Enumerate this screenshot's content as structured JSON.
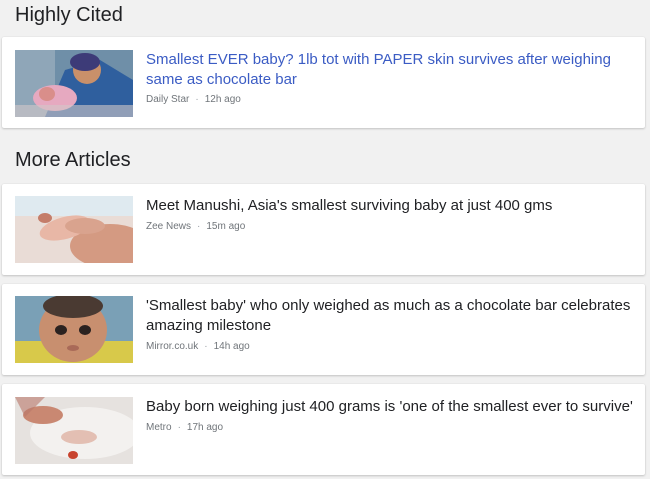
{
  "highly_cited": {
    "heading": "Highly Cited",
    "articles": [
      {
        "headline": "Smallest EVER baby? 1lb tot with PAPER skin survives after weighing same as chocolate bar",
        "source": "Daily Star",
        "separator": "·",
        "time": "12h ago"
      }
    ]
  },
  "more_articles": {
    "heading": "More Articles",
    "articles": [
      {
        "headline": "Meet Manushi, Asia's smallest surviving baby at just 400 gms",
        "source": "Zee News",
        "separator": "·",
        "time": "15m ago"
      },
      {
        "headline": "'Smallest baby' who only weighed as much as a chocolate bar celebrates amazing milestone",
        "source": "Mirror.co.uk",
        "separator": "·",
        "time": "14h ago"
      },
      {
        "headline": "Baby born weighing just 400 grams is 'one of the smallest ever to survive'",
        "source": "Metro",
        "separator": "·",
        "time": "17h ago"
      }
    ]
  },
  "colors": {
    "page_background": "#f1f1f1",
    "card_background": "#ffffff",
    "featured_link": "#3b5cc4",
    "headline_text": "#202124",
    "meta_text": "#70757a"
  }
}
